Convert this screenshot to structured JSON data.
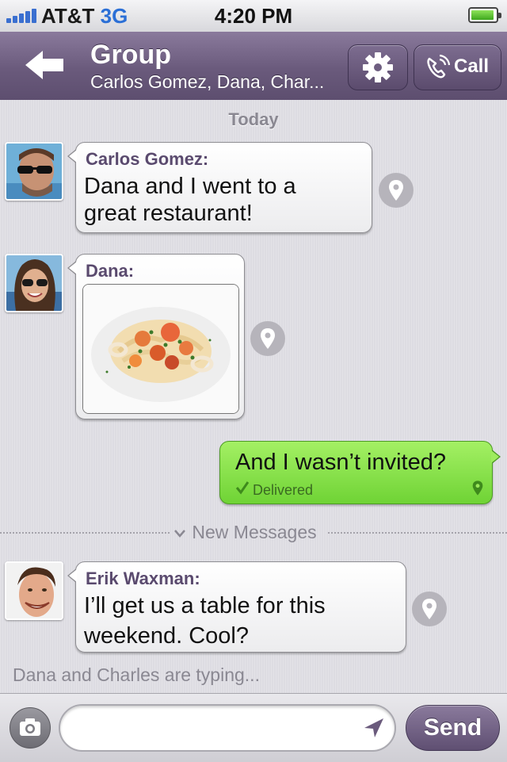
{
  "status_bar": {
    "carrier": "AT&T",
    "network": "3G",
    "time": "4:20 PM",
    "battery_level": 0.9
  },
  "nav": {
    "title": "Group",
    "subtitle": "Carlos Gomez, Dana, Char...",
    "back_icon": "back-arrow-icon",
    "settings_icon": "gear-icon",
    "call_icon": "phone-icon",
    "call_label": "Call"
  },
  "chat": {
    "date_label": "Today",
    "messages": [
      {
        "sender": "Carlos Gomez:",
        "text_line1": "Dana and I went to a",
        "text_line2": "great restaurant!"
      },
      {
        "sender": "Dana:",
        "photo": "shrimp-pasta-photo"
      },
      {
        "text": "And I wasn’t invited?",
        "status": "Delivered",
        "status_icon": "checkmark-icon"
      },
      {
        "sender": "Erik Waxman:",
        "text_line1": "I’ll get us a table for this",
        "text_line2": "weekend. Cool?"
      }
    ],
    "new_messages_label": "New Messages",
    "typing_indicator": "Dana and Charles are typing..."
  },
  "input_bar": {
    "camera_icon": "camera-icon",
    "message_placeholder": "",
    "location_icon": "location-arrow-icon",
    "send_label": "Send"
  },
  "colors": {
    "accent": "#6a5a7c",
    "outgoing_bubble": "#8ee24c",
    "sender_name": "#5a4a6e"
  }
}
